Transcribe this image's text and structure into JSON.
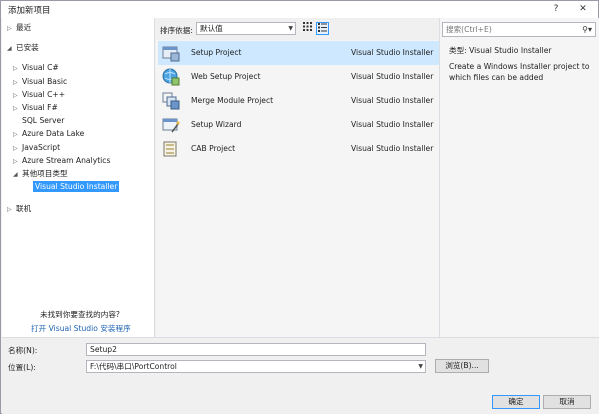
{
  "window": {
    "title": "添加新项目",
    "help": "?",
    "close": "✕"
  },
  "tree": {
    "items": [
      {
        "label": "最近",
        "arrow": "▷"
      },
      {
        "label": "已安装",
        "arrow": "◢"
      },
      {
        "label": "Visual C#",
        "arrow": "▷"
      },
      {
        "label": "Visual Basic",
        "arrow": "▷"
      },
      {
        "label": "Visual C++",
        "arrow": "▷"
      },
      {
        "label": "Visual F#",
        "arrow": "▷"
      },
      {
        "label": "SQL Server",
        "arrow": ""
      },
      {
        "label": "Azure Data Lake",
        "arrow": "▷"
      },
      {
        "label": "JavaScript",
        "arrow": "▷"
      },
      {
        "label": "Azure Stream Analytics",
        "arrow": "▷"
      },
      {
        "label": "其他项目类型",
        "arrow": "◢"
      },
      {
        "label": "Visual Studio Installer",
        "arrow": ""
      },
      {
        "label": "联机",
        "arrow": "▷"
      }
    ],
    "not_found": "未找到你要查找的内容?",
    "open_installer": "打开 Visual Studio 安装程序"
  },
  "sort": {
    "label": "排序依据:",
    "value": "默认值"
  },
  "templates": [
    {
      "name": "Setup Project",
      "type": "Visual Studio Installer",
      "icon": "setup-project-icon"
    },
    {
      "name": "Web Setup Project",
      "type": "Visual Studio Installer",
      "icon": "web-setup-icon"
    },
    {
      "name": "Merge Module Project",
      "type": "Visual Studio Installer",
      "icon": "merge-module-icon"
    },
    {
      "name": "Setup Wizard",
      "type": "Visual Studio Installer",
      "icon": "setup-wizard-icon"
    },
    {
      "name": "CAB Project",
      "type": "Visual Studio Installer",
      "icon": "cab-project-icon"
    }
  ],
  "details": {
    "search_placeholder": "搜索(Ctrl+E)",
    "type_line": "类型: Visual Studio Installer",
    "description": "Create a Windows Installer project to which files can be added"
  },
  "form": {
    "name_label": "名称(N):",
    "name_value": "Setup2",
    "location_label": "位置(L):",
    "location_value": "F:\\代码\\串口\\PortControl",
    "browse": "浏览(B)...",
    "ok": "确定",
    "cancel": "取消"
  },
  "colors": {
    "selection": "#3399ff",
    "selected_row": "#cde8ff",
    "link": "#1e63b5"
  }
}
